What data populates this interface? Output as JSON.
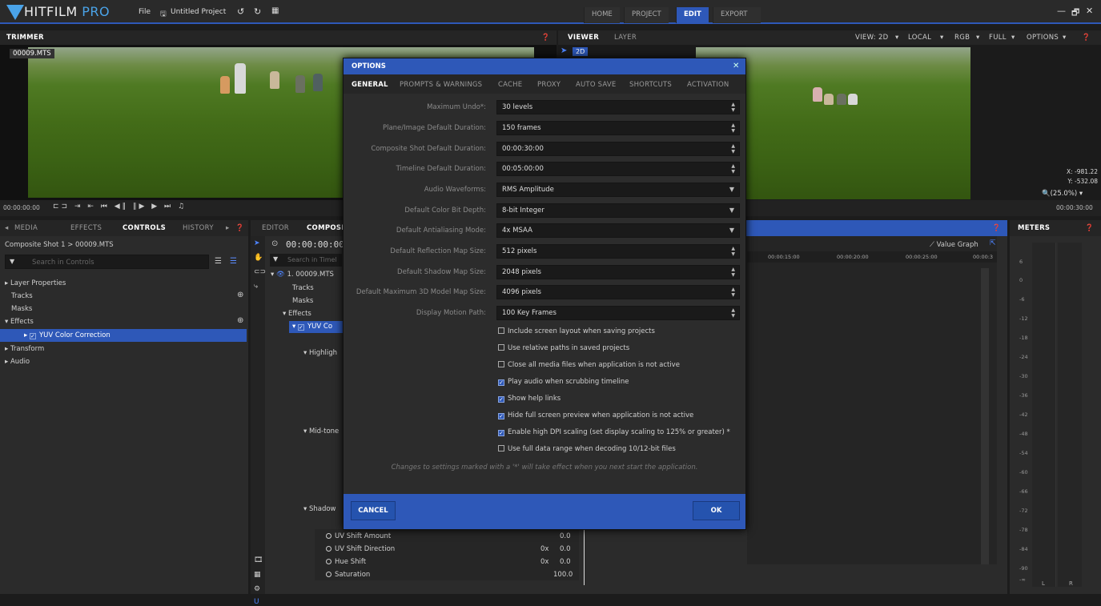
{
  "app": {
    "logo_main": "HITFILM",
    "logo_pro": "PRO",
    "file_menu": "File",
    "project_name": "Untitled Project"
  },
  "nav": [
    {
      "label": "HOME"
    },
    {
      "label": "PROJECT"
    },
    {
      "label": "EDIT"
    },
    {
      "label": "EXPORT"
    }
  ],
  "window_controls": {
    "minimize": "—",
    "restore": "🗗",
    "close": "✕"
  },
  "trimmer": {
    "title": "TRIMMER",
    "clip_name": "00009.MTS",
    "timecode": "00:00:00:00"
  },
  "viewer": {
    "tabs": [
      "VIEWER",
      "LAYER"
    ],
    "view": "VIEW: 2D",
    "local": "LOCAL",
    "rgb": "RGB",
    "full": "FULL",
    "options": "OPTIONS",
    "mode_2d": "2D",
    "x": "X:  -981.22",
    "y": "Y:  -532.08",
    "zoom": "(25.0%)",
    "end_time": "00:00:30:00"
  },
  "left_tabs": [
    "MEDIA",
    "EFFECTS",
    "CONTROLS",
    "HISTORY"
  ],
  "controls": {
    "breadcrumb": "Composite Shot 1 > 00009.MTS",
    "search_placeholder": "Search in Controls",
    "tree": [
      "Layer Properties",
      "Tracks",
      "Masks",
      "Effects",
      "YUV Color Correction",
      "Transform",
      "Audio"
    ]
  },
  "editor": {
    "tabs": [
      "EDITOR",
      "COMPOSI"
    ],
    "timecode": "00:00:00:00",
    "search_placeholder": "Search in Timel",
    "layer": "1. 00009.MTS",
    "items": [
      "Tracks",
      "Masks",
      "Effects",
      "YUV Co",
      "Highligh",
      "Mid-tone",
      "Shadow"
    ],
    "bottom_rows": [
      {
        "name": "UV Shift Amount",
        "a": "",
        "b": "0.0"
      },
      {
        "name": "UV Shift Direction",
        "a": "0x",
        "b": "0.0"
      },
      {
        "name": "Hue Shift",
        "a": "0x",
        "b": "0.0"
      },
      {
        "name": "Saturation",
        "a": "",
        "b": "100.0"
      }
    ],
    "value_graph": "Value Graph",
    "ruler": [
      "00:00:15:00",
      "00:00:20:00",
      "00:00:25:00",
      "00:00:3"
    ]
  },
  "meters": {
    "title": "METERS",
    "ticks": [
      "6",
      "0",
      "-6",
      "-12",
      "-18",
      "-24",
      "-30",
      "-36",
      "-42",
      "-48",
      "-54",
      "-60",
      "-66",
      "-72",
      "-78",
      "-84",
      "-90",
      "-∞"
    ],
    "left": "L",
    "right": "R"
  },
  "dialog": {
    "title": "OPTIONS",
    "tabs": [
      "GENERAL",
      "PROMPTS & WARNINGS",
      "CACHE",
      "PROXY",
      "AUTO SAVE",
      "SHORTCUTS",
      "ACTIVATION"
    ],
    "rows": [
      {
        "label": "Maximum Undo*:",
        "value": "30 levels",
        "kind": "spin"
      },
      {
        "label": "Plane/Image Default Duration:",
        "value": "150 frames",
        "kind": "spin"
      },
      {
        "label": "Composite Shot Default Duration:",
        "value": "00:00:30:00",
        "kind": "spin"
      },
      {
        "label": "Timeline Default Duration:",
        "value": "00:05:00:00",
        "kind": "spin"
      },
      {
        "label": "Audio Waveforms:",
        "value": "RMS Amplitude",
        "kind": "select"
      },
      {
        "label": "Default Color Bit Depth:",
        "value": "8-bit Integer",
        "kind": "select"
      },
      {
        "label": "Default Antialiasing Mode:",
        "value": "4x MSAA",
        "kind": "select"
      },
      {
        "label": "Default Reflection Map Size:",
        "value": "512 pixels",
        "kind": "spin"
      },
      {
        "label": "Default Shadow Map Size:",
        "value": "2048 pixels",
        "kind": "spin"
      },
      {
        "label": "Default Maximum 3D Model Map Size:",
        "value": "4096 pixels",
        "kind": "spin"
      },
      {
        "label": "Display Motion Path:",
        "value": "100 Key Frames",
        "kind": "spin"
      }
    ],
    "checkboxes": [
      {
        "label": "Include screen layout when saving projects",
        "checked": false
      },
      {
        "label": "Use relative paths in saved projects",
        "checked": false
      },
      {
        "label": "Close all media files when application is not active",
        "checked": false
      },
      {
        "label": "Play audio when scrubbing timeline",
        "checked": true
      },
      {
        "label": "Show help links",
        "checked": true
      },
      {
        "label": "Hide full screen preview when application is not active",
        "checked": true
      },
      {
        "label": "Enable high DPI scaling (set display scaling to 125% or greater) *",
        "checked": true
      },
      {
        "label": "Use full data range when decoding 10/12-bit files",
        "checked": false
      }
    ],
    "note": "Changes to settings marked with a '*' will take effect when you next start the application.",
    "cancel": "CANCEL",
    "ok": "OK"
  }
}
